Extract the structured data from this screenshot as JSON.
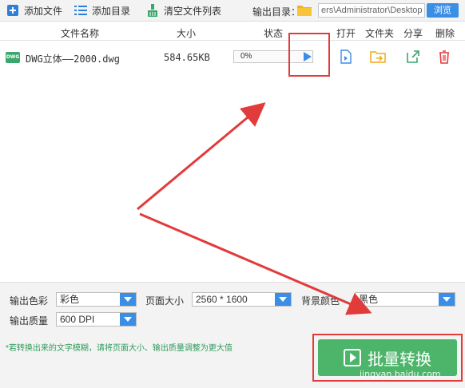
{
  "toolbar": {
    "add_file": "添加文件",
    "add_dir": "添加目录",
    "clear_list": "清空文件列表",
    "output_dir_label": "输出目录：",
    "output_path": "ers\\Administrator\\Desktop",
    "browse": "浏览"
  },
  "table": {
    "headers": {
      "name": "文件名称",
      "size": "大小",
      "status": "状态",
      "open": "打开",
      "folder": "文件夹",
      "share": "分享",
      "delete": "删除"
    },
    "rows": [
      {
        "icon_text": "DWG",
        "name": "DWG立体——2000.dwg",
        "size": "584.65KB",
        "progress_text": "0%",
        "progress": 0
      }
    ]
  },
  "options": {
    "color_label": "输出色彩",
    "color_value": "彩色",
    "page_size_label": "页面大小",
    "page_size_value": "2560 * 1600",
    "bg_color_label": "背景颜色",
    "bg_color_value": "黑色",
    "quality_label": "输出质量",
    "quality_value": "600 DPI"
  },
  "footer": {
    "tip": "*若转换出来的文字模糊，请将页面大小、输出质量调整为更大值",
    "convert": "批量转换",
    "watermark": "jingyan.baidu.com"
  },
  "colors": {
    "accent": "#3b8ee6",
    "convert_green": "#4cb56a",
    "annotation_red": "#e23b3b"
  }
}
